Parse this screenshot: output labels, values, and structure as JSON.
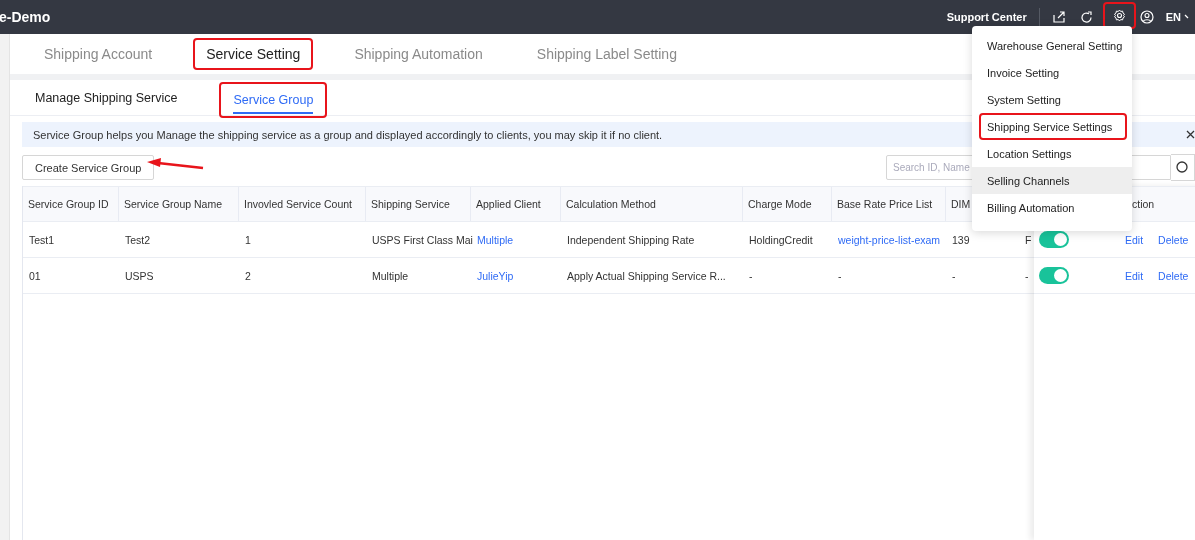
{
  "app": {
    "title": "e-Demo"
  },
  "topbar": {
    "support": "Support Center",
    "language": "EN",
    "gear_highlighted": true
  },
  "tabs": [
    {
      "label": "Shipping Account",
      "selected": false,
      "highlighted": false
    },
    {
      "label": "Service Setting",
      "selected": true,
      "highlighted": true
    },
    {
      "label": "Shipping Automation",
      "selected": false,
      "highlighted": false
    },
    {
      "label": "Shipping Label Setting",
      "selected": false,
      "highlighted": false
    }
  ],
  "subtabs": [
    {
      "label": "Manage Shipping Service",
      "selected": false,
      "highlighted": false
    },
    {
      "label": "Service Group",
      "selected": true,
      "highlighted": true
    }
  ],
  "banner": {
    "text": "Service Group helps you Manage the shipping service as a group and displayed accordingly to clients, you may skip it if no client."
  },
  "create_button": {
    "label": "Create Service Group",
    "pointed": true
  },
  "search": {
    "placeholder": "Search ID, Name"
  },
  "table": {
    "columns": [
      "Service Group ID",
      "Service Group Name",
      "Invovled Service Count",
      "Shipping Service",
      "Applied Client",
      "Calculation Method",
      "Charge Mode",
      "Base Rate Price List",
      "DIM"
    ],
    "action_column": "ction",
    "rows": [
      {
        "cells": [
          {
            "text": "Test1",
            "kind": "text"
          },
          {
            "text": "Test2",
            "kind": "text"
          },
          {
            "text": "1",
            "kind": "text"
          },
          {
            "text": "USPS First Class Mai",
            "kind": "text"
          },
          {
            "text": "Multiple",
            "kind": "link"
          },
          {
            "text": "Independent Shipping Rate",
            "kind": "text"
          },
          {
            "text": "HoldingCredit",
            "kind": "text"
          },
          {
            "text": "weight-price-list-exam",
            "kind": "link"
          },
          {
            "text": "139",
            "kind": "text"
          },
          {
            "text": "F",
            "kind": "text"
          }
        ],
        "enabled": true,
        "actions": [
          "Edit",
          "Delete"
        ]
      },
      {
        "cells": [
          {
            "text": "01",
            "kind": "text"
          },
          {
            "text": "USPS",
            "kind": "text"
          },
          {
            "text": "2",
            "kind": "text"
          },
          {
            "text": "Multiple",
            "kind": "text"
          },
          {
            "text": "JulieYip",
            "kind": "link"
          },
          {
            "text": "Apply Actual Shipping Service R...",
            "kind": "text"
          },
          {
            "text": "-",
            "kind": "text"
          },
          {
            "text": "-",
            "kind": "text"
          },
          {
            "text": "-",
            "kind": "text"
          },
          {
            "text": "-",
            "kind": "text"
          }
        ],
        "enabled": true,
        "actions": [
          "Edit",
          "Delete"
        ]
      }
    ]
  },
  "settings_menu": {
    "items": [
      {
        "label": "Warehouse General Setting",
        "hovered": false,
        "highlighted": false
      },
      {
        "label": "Invoice Setting",
        "hovered": false,
        "highlighted": false
      },
      {
        "label": "System Setting",
        "hovered": false,
        "highlighted": false
      },
      {
        "label": "Shipping Service Settings",
        "hovered": false,
        "highlighted": true
      },
      {
        "label": "Location Settings",
        "hovered": false,
        "highlighted": false
      },
      {
        "label": "Selling Channels",
        "hovered": true,
        "highlighted": false
      },
      {
        "label": "Billing Automation",
        "hovered": false,
        "highlighted": false
      }
    ]
  }
}
